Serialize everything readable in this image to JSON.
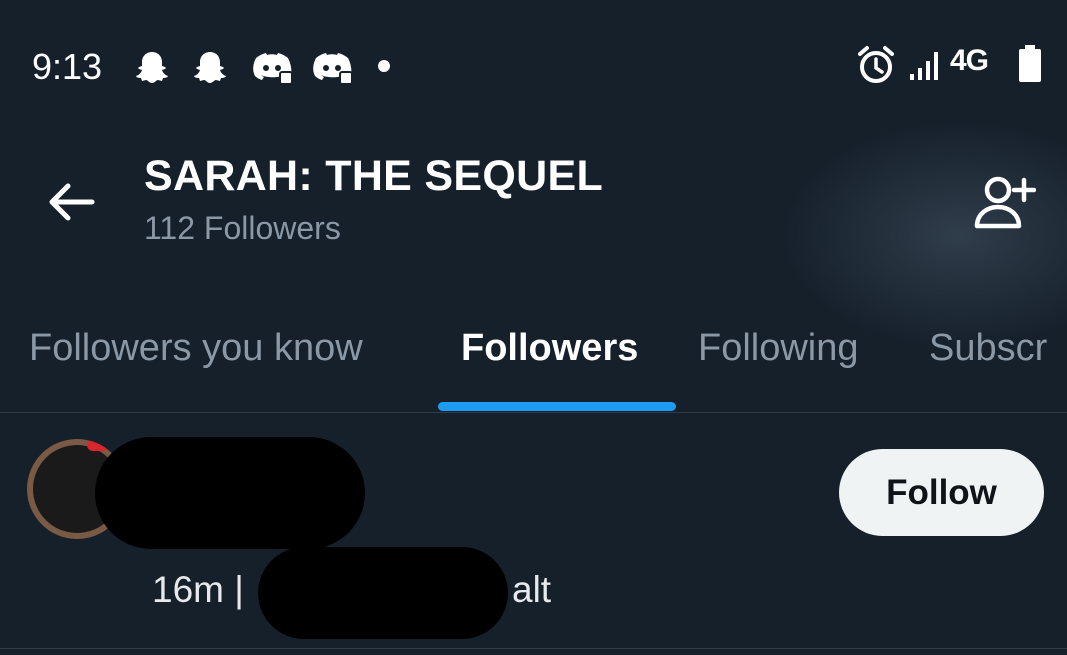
{
  "status_bar": {
    "time": "9:13",
    "left_icons": [
      "snapchat-icon",
      "snapchat-icon",
      "discord-icon",
      "discord-icon",
      "dot-icon"
    ],
    "right_icons": [
      "alarm-icon",
      "signal-icon",
      "battery-icon"
    ],
    "network": "4G"
  },
  "header": {
    "back_icon": "back-arrow-icon",
    "title": "SARAH: THE SEQUEL",
    "subtitle": "112 Followers",
    "add_user_icon": "add-user-icon"
  },
  "tabs": [
    {
      "label": "Followers you know",
      "active": false
    },
    {
      "label": "Followers",
      "active": true
    },
    {
      "label": "Following",
      "active": false
    },
    {
      "label": "Subscr",
      "active": false
    }
  ],
  "accent_color": "#1d9bf0",
  "followers": [
    {
      "meta_prefix": "16m |",
      "meta_suffix": "alt",
      "follow_label": "Follow"
    }
  ]
}
